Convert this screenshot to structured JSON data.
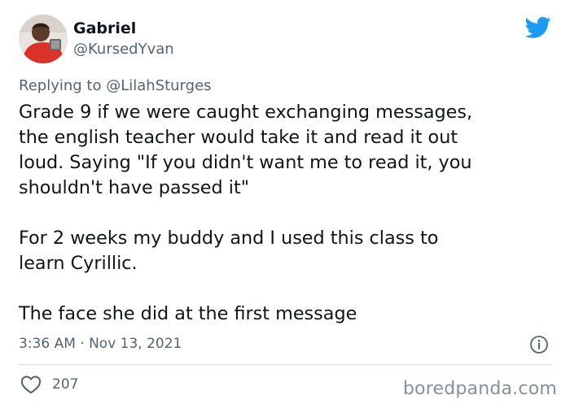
{
  "tweet": {
    "author": {
      "display_name": "Gabriel",
      "handle": "@KursedYvan",
      "avatar_icon": "avatar-photo"
    },
    "reply_prefix": "Replying to ",
    "reply_mention": "@LilahSturges",
    "paragraphs": [
      "Grade 9 if we were caught exchanging messages,\nthe english teacher would take it and read it out\nloud. Saying \"If you didn't want me to read it, you\nshouldn't have passed it\"",
      "For 2 weeks my buddy and I used this class to\nlearn Cyrillic.",
      "The face she did at the first message"
    ],
    "timestamp": "3:36 AM · Nov 13, 2021",
    "like_count": "207"
  },
  "icons": {
    "platform": "twitter-bird-icon",
    "info": "info-icon",
    "like": "heart-icon"
  },
  "watermark": "boredpanda.com",
  "colors": {
    "twitter_blue": "#1d9bf0",
    "text_primary": "#0f1419",
    "text_secondary": "#536471",
    "divider": "#cfd9de"
  }
}
